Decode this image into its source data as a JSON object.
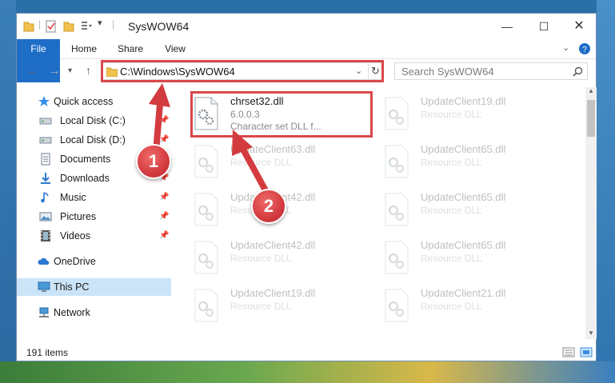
{
  "window": {
    "title": "SysWOW64",
    "minimize_icon": "minimize-icon",
    "maximize_icon": "maximize-icon",
    "close_icon": "close-icon"
  },
  "ribbon": {
    "tabs": [
      "File",
      "Home",
      "Share",
      "View"
    ]
  },
  "address_bar": {
    "path": "C:\\Windows\\SysWOW64",
    "refresh_icon": "refresh-icon"
  },
  "search": {
    "placeholder": "Search SysWOW64"
  },
  "sidebar": {
    "items": [
      {
        "label": "Quick access",
        "icon": "star-icon",
        "pinned": false
      },
      {
        "label": "Local Disk (C:)",
        "icon": "drive-icon",
        "pinned": true
      },
      {
        "label": "Local Disk (D:)",
        "icon": "drive-icon",
        "pinned": true
      },
      {
        "label": "Documents",
        "icon": "documents-icon",
        "pinned": true
      },
      {
        "label": "Downloads",
        "icon": "downloads-icon",
        "pinned": true
      },
      {
        "label": "Music",
        "icon": "music-icon",
        "pinned": true
      },
      {
        "label": "Pictures",
        "icon": "pictures-icon",
        "pinned": true
      },
      {
        "label": "Videos",
        "icon": "videos-icon",
        "pinned": true
      },
      {
        "label": "OneDrive",
        "icon": "cloud-icon",
        "pinned": false
      },
      {
        "label": "This PC",
        "icon": "computer-icon",
        "pinned": false,
        "selected": true
      },
      {
        "label": "Network",
        "icon": "network-icon",
        "pinned": false
      }
    ]
  },
  "files": [
    {
      "name": "chrset32.dll",
      "line2": "6.0.0.3",
      "line3": "Character set DLL f...",
      "faded": false
    },
    {
      "name": "UpdateClient19.dll",
      "line2": "Resource DLL",
      "faded": true
    },
    {
      "name": "UpdateClient63.dll",
      "line2": "Resource DLL",
      "faded": true
    },
    {
      "name": "UpdateClient65.dll",
      "line2": "Resource DLL",
      "faded": true
    },
    {
      "name": "UpdateClient42.dll",
      "line2": "Resource DLL",
      "faded": true
    },
    {
      "name": "UpdateClient65.dll",
      "line2": "Resource DLL",
      "faded": true
    },
    {
      "name": "UpdateClient42.dll",
      "line2": "Resource DLL",
      "faded": true
    },
    {
      "name": "UpdateClient65.dll",
      "line2": "Resource DLL",
      "faded": true
    },
    {
      "name": "UpdateClient19.dll",
      "line2": "Resource DLL",
      "faded": true
    },
    {
      "name": "UpdateClient21.dll",
      "line2": "Resource DLL",
      "faded": true
    }
  ],
  "status": {
    "item_count": "191 items"
  },
  "callouts": [
    "1",
    "2"
  ],
  "colors": {
    "accent": "#1e6ec8",
    "highlight": "#d9474b",
    "selection": "#cce4f7"
  }
}
